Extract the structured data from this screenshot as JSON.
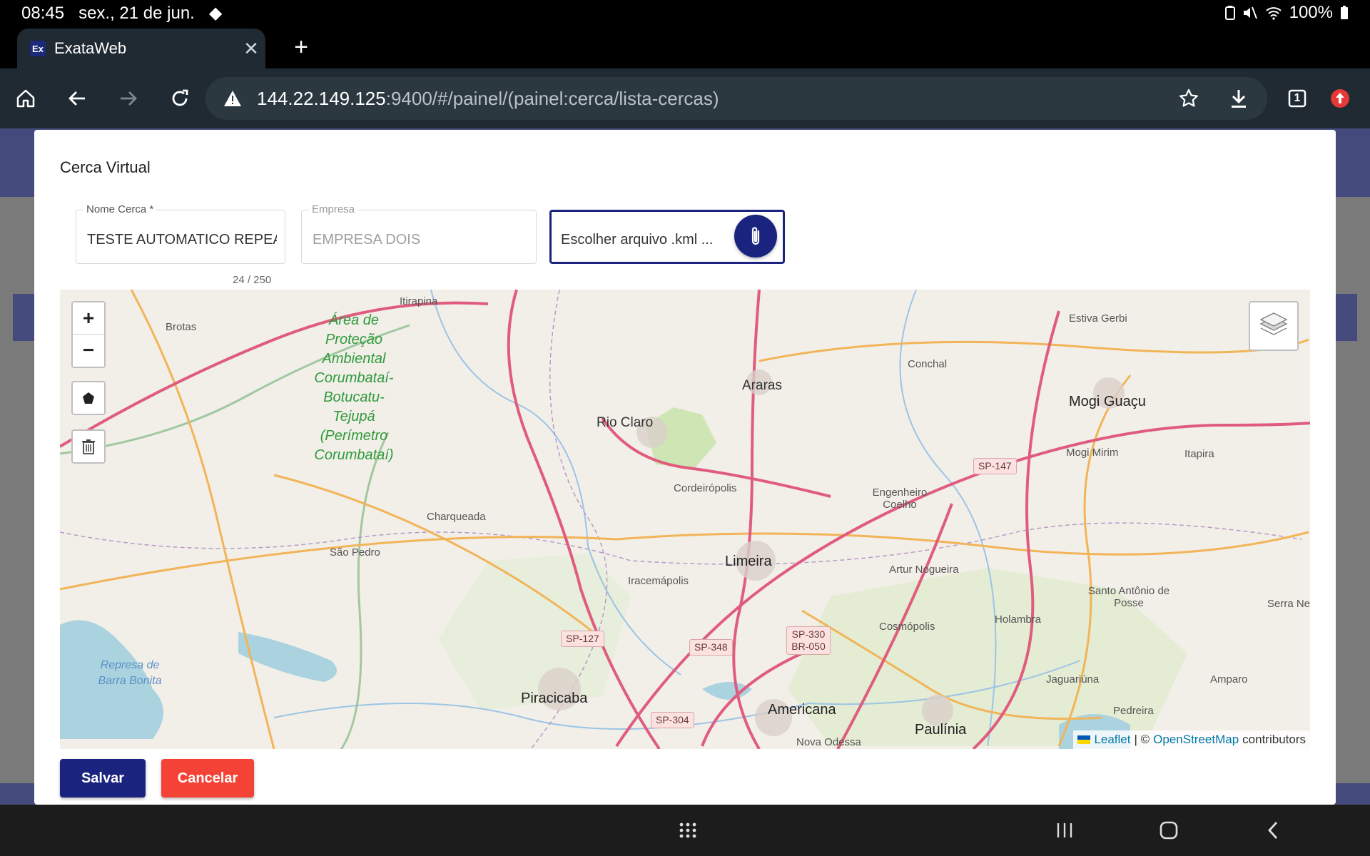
{
  "statusbar": {
    "time": "08:45",
    "date": "sex., 21 de jun.",
    "battery": "100%"
  },
  "browser": {
    "tab_title": "ExataWeb",
    "tab_favicon": "Ex",
    "url_host": "144.22.149.125",
    "url_rest": ":9400/#/painel/(painel:cerca/lista-cercas)",
    "tab_count": "1"
  },
  "modal": {
    "title": "Cerca Virtual",
    "nome_label": "Nome Cerca *",
    "nome_value": "TESTE AUTOMATICO REPEAT",
    "nome_counter": "24 / 250",
    "empresa_label": "Empresa",
    "empresa_value": "EMPRESA DOIS",
    "file_value": "Escolher arquivo .kml ...",
    "save_label": "Salvar",
    "cancel_label": "Cancelar"
  },
  "map": {
    "zoom_in": "+",
    "zoom_out": "−",
    "attribution_leaflet": "Leaflet",
    "attribution_sep": "| ©",
    "attribution_osm": "OpenStreetMap",
    "attribution_tail": "contributors",
    "labels": {
      "itirapina": "Itirapina",
      "brotas": "Brotas",
      "apa": "Área de Proteção Ambiental Corumbataí-Botucatu-Tejupá (Perímetro Corumbataí)",
      "araras": "Araras",
      "conchal": "Conchal",
      "estiva": "Estiva Gerbi",
      "mogi_guacu": "Mogi Guaçu",
      "rio_claro": "Rio Claro",
      "sp147": "SP-147",
      "mogi_mirim": "Mogi Mirim",
      "itapira": "Itapira",
      "cordeiropolis": "Cordeirópolis",
      "engenheiro": "Engenheiro Coelho",
      "charqueada": "Charqueada",
      "sao_pedro": "São Pedro",
      "limeira": "Limeira",
      "artur": "Artur Nogueira",
      "iracemapolis": "Iracemápolis",
      "santo_antonio": "Santo Antônio de Posse",
      "serra_negra": "Serra Ne",
      "holambra": "Holambra",
      "cosmopolis": "Cosmópolis",
      "sp330": "SP-330 BR-050",
      "sp127": "SP-127",
      "sp348": "SP-348",
      "represa": "Represa de Barra Bonita",
      "jaguariuna": "Jaguariúna",
      "amparo": "Amparo",
      "piracicaba": "Piracicaba",
      "pedreira": "Pedreira",
      "americana": "Americana",
      "sp304": "SP-304",
      "paulinia": "Paulínia",
      "nova_odessa": "Nova Odessa"
    }
  },
  "colors": {
    "primary": "#1a237e",
    "danger": "#f44336",
    "map_bg": "#f2efe9",
    "highway": "#e05c7e",
    "secondary_road": "#f2b458",
    "water": "#aad3df"
  }
}
